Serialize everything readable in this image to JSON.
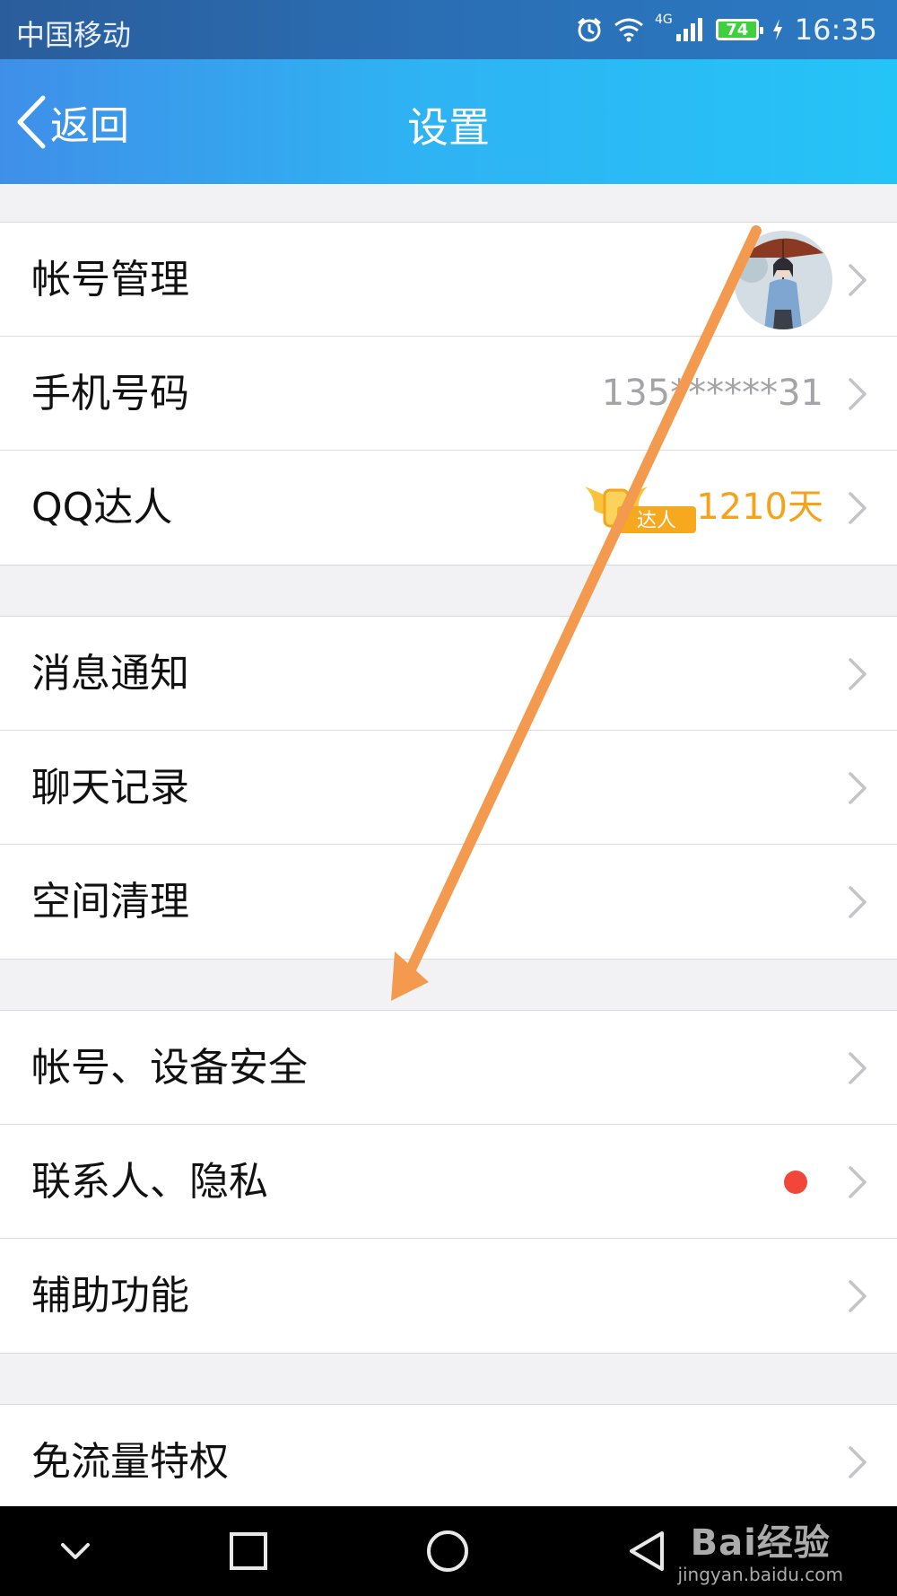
{
  "status_bar": {
    "carrier": "中国移动",
    "network": "4G",
    "battery": "74",
    "time": "16:35"
  },
  "nav": {
    "back_label": "返回",
    "title": "设置"
  },
  "groups": [
    {
      "rows": [
        {
          "label": "帐号管理",
          "accessory": "avatar"
        },
        {
          "label": "手机号码",
          "value": "135******31"
        },
        {
          "label": "QQ达人",
          "badge": "达人",
          "value": "1210天"
        }
      ]
    },
    {
      "rows": [
        {
          "label": "消息通知"
        },
        {
          "label": "聊天记录"
        },
        {
          "label": "空间清理"
        }
      ]
    },
    {
      "rows": [
        {
          "label": "帐号、设备安全"
        },
        {
          "label": "联系人、隐私",
          "accessory": "red-dot"
        },
        {
          "label": "辅助功能"
        }
      ]
    },
    {
      "rows": [
        {
          "label": "免流量特权"
        }
      ]
    }
  ],
  "watermark": {
    "brand": "Bai经验",
    "url": "jingyan.baidu.com"
  },
  "colors": {
    "accent": "#2fb2f3",
    "value_orange": "#f4a31a",
    "red_dot": "#f1473a",
    "annotation_arrow": "#f39a4f"
  }
}
